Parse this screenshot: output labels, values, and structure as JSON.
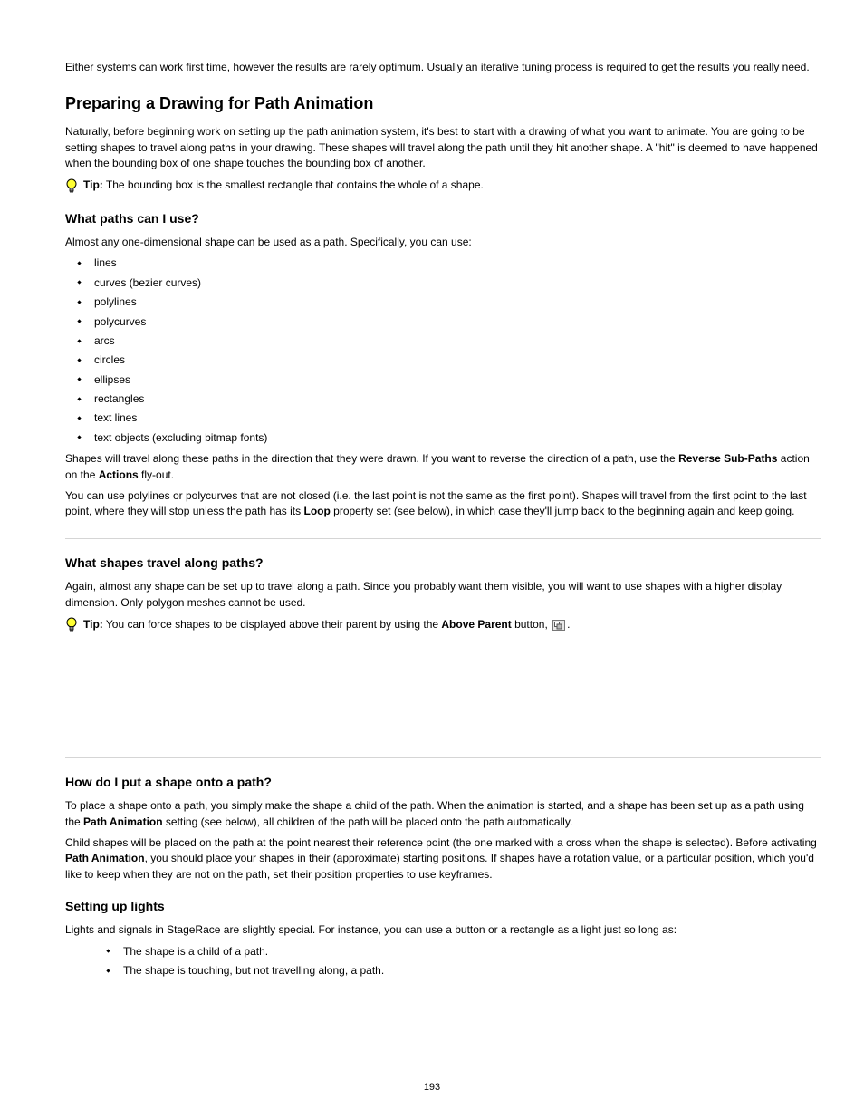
{
  "page_number": "193",
  "section1": {
    "para1": "Either systems can work first time, however the results are rarely optimum. Usually an iterative tuning process is required to get the results you really need.",
    "title": "Preparing a Drawing for Path Animation",
    "para2_a": "Naturally, before beginning work on setting up the path animation system, it's best to start with a drawing of what you want to animate. You are going to be setting shapes to travel along paths in",
    "para2_b": "your drawing. These shapes will travel along the path until they hit another shape. A \"hit\" is deemed to have happened when the bounding box of one shape touches the bounding box of another.",
    "tip_label": "Tip:",
    "tip_text": "The bounding box is the smallest rectangle that contains the whole of a shape.",
    "subtitle": "What paths can I use?",
    "para3": "Almost any one-dimensional shape can be used as a path. Specifically, you can use:",
    "bullets": [
      "lines",
      "curves (bezier curves)",
      "polylines",
      "polycurves",
      "arcs",
      "circles",
      "ellipses",
      "rectangles",
      "text lines",
      "text objects (excluding bitmap fonts)"
    ],
    "para4_a": "Shapes will travel along these paths in the direction that they were drawn. If you want to reverse the direction of a path, use the ",
    "para4_b": "Reverse Sub-Paths",
    "para4_c": " action on the ",
    "para4_d": "Actions",
    "para4_e": " fly-out.",
    "para5_a": "You can use polylines or polycurves that are not closed (i.e. the last point is not the same as the first point). Shapes will travel from the first point to the last point, where they will stop unless the path has its ",
    "para5_b": "Loop",
    "para5_c": " property set (see below), in which case they'll jump back to the beginning again and keep going."
  },
  "section2": {
    "title": "What shapes travel along paths?",
    "para1": "Again, almost any shape can be set up to travel along a path. Since you probably want them visible, you will want to use shapes with a higher display dimension. Only polygon meshes cannot be used.",
    "tip_label": "Tip:",
    "tip_a": "You can force shapes to be displayed above their parent by using the ",
    "tip_b": "Above Parent",
    "tip_c": " button, ",
    "tip_d": "."
  },
  "section3": {
    "title": "How do I put a shape onto a path?",
    "para1_a": "To place a shape onto a path, you simply make the shape a child of the path. When the animation is started, and a shape has been set up as a path using the ",
    "para1_b": "Path Animation",
    "para1_c": " setting (see below), all children of the path will be placed onto the path automatically.",
    "para2_a": "Child shapes will be placed on the path at the point nearest their reference point (the one marked with a cross when the shape is selected). Before activating ",
    "para2_b": "Path Animation",
    "para2_c": ", you should place your shapes in their (approximate) starting positions. If shapes have a rotation value, or a particular position, which you'd like to keep when they are not on the path, set their position properties to use keyframes.",
    "title2": "Setting up lights",
    "para3": "Lights and signals in StageRace are slightly special. For instance, you can use a button or a rectangle as a light just so long as:",
    "bullets2": [
      "The shape is a child of a path.",
      "The shape is touching, but not travelling along, a path."
    ]
  }
}
